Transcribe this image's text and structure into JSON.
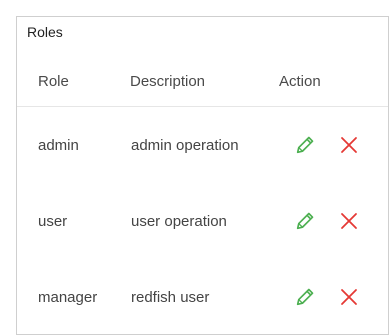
{
  "panel": {
    "title": "Roles"
  },
  "table": {
    "headers": {
      "role": "Role",
      "description": "Description",
      "action": "Action"
    },
    "rows": [
      {
        "role": "admin",
        "description": "admin operation"
      },
      {
        "role": "user",
        "description": "user operation"
      },
      {
        "role": "manager",
        "description": "redfish user"
      }
    ]
  },
  "icons": {
    "edit": "pencil-icon",
    "delete": "close-icon"
  },
  "colors": {
    "edit": "#4caf50",
    "delete": "#e53935",
    "border": "#cfcfcf"
  }
}
